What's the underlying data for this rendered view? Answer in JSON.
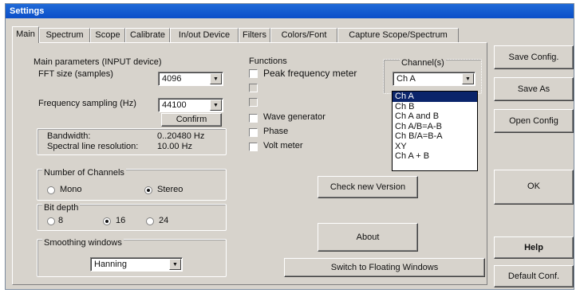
{
  "window": {
    "title": "Settings"
  },
  "tabs": [
    "Main",
    "Spectrum",
    "Scope",
    "Calibrate",
    "In/out Device",
    "Filters",
    "Colors/Font",
    "Capture Scope/Spectrum"
  ],
  "main_params": {
    "heading": "Main parameters (INPUT device)",
    "fft_label": "FFT size (samples)",
    "fft_value": "4096",
    "freq_label": "Frequency sampling (Hz)",
    "freq_value": "44100",
    "confirm": "Confirm",
    "bandwidth_label": "Bandwidth:",
    "bandwidth_value": "0..20480 Hz",
    "resolution_label": "Spectral line resolution:",
    "resolution_value": "10.00 Hz"
  },
  "channels_group": {
    "label": "Number of Channels",
    "mono": "Mono",
    "stereo": "Stereo",
    "selected": "Stereo"
  },
  "bitdepth_group": {
    "label": "Bit depth",
    "opt8": "8",
    "opt16": "16",
    "opt24": "24",
    "selected": "16"
  },
  "smoothing_group": {
    "label": "Smoothing windows",
    "value": "Hanning"
  },
  "functions": {
    "heading": "Functions",
    "items": [
      {
        "label": "Peak frequency meter",
        "enabled": true
      },
      {
        "label": "",
        "enabled": false
      },
      {
        "label": "",
        "enabled": false
      },
      {
        "label": "Wave generator",
        "enabled": true
      },
      {
        "label": "Phase",
        "enabled": true
      },
      {
        "label": "Volt meter",
        "enabled": true
      }
    ]
  },
  "channel_select": {
    "label": "Channel(s)",
    "value": "Ch A",
    "options": [
      "Ch A",
      "Ch B",
      "Ch A and B",
      "Ch A/B=A-B",
      "Ch B/A=B-A",
      "XY",
      "Ch A + B"
    ],
    "highlighted": "Ch A"
  },
  "buttons": {
    "check_version": "Check new Version",
    "about": "About",
    "floating": "Switch to Floating Windows"
  },
  "right_buttons": {
    "save_config": "Save Config.",
    "save_as": "Save As",
    "open_config": "Open Config",
    "ok": "OK",
    "help": "Help",
    "default_conf": "Default Conf."
  }
}
